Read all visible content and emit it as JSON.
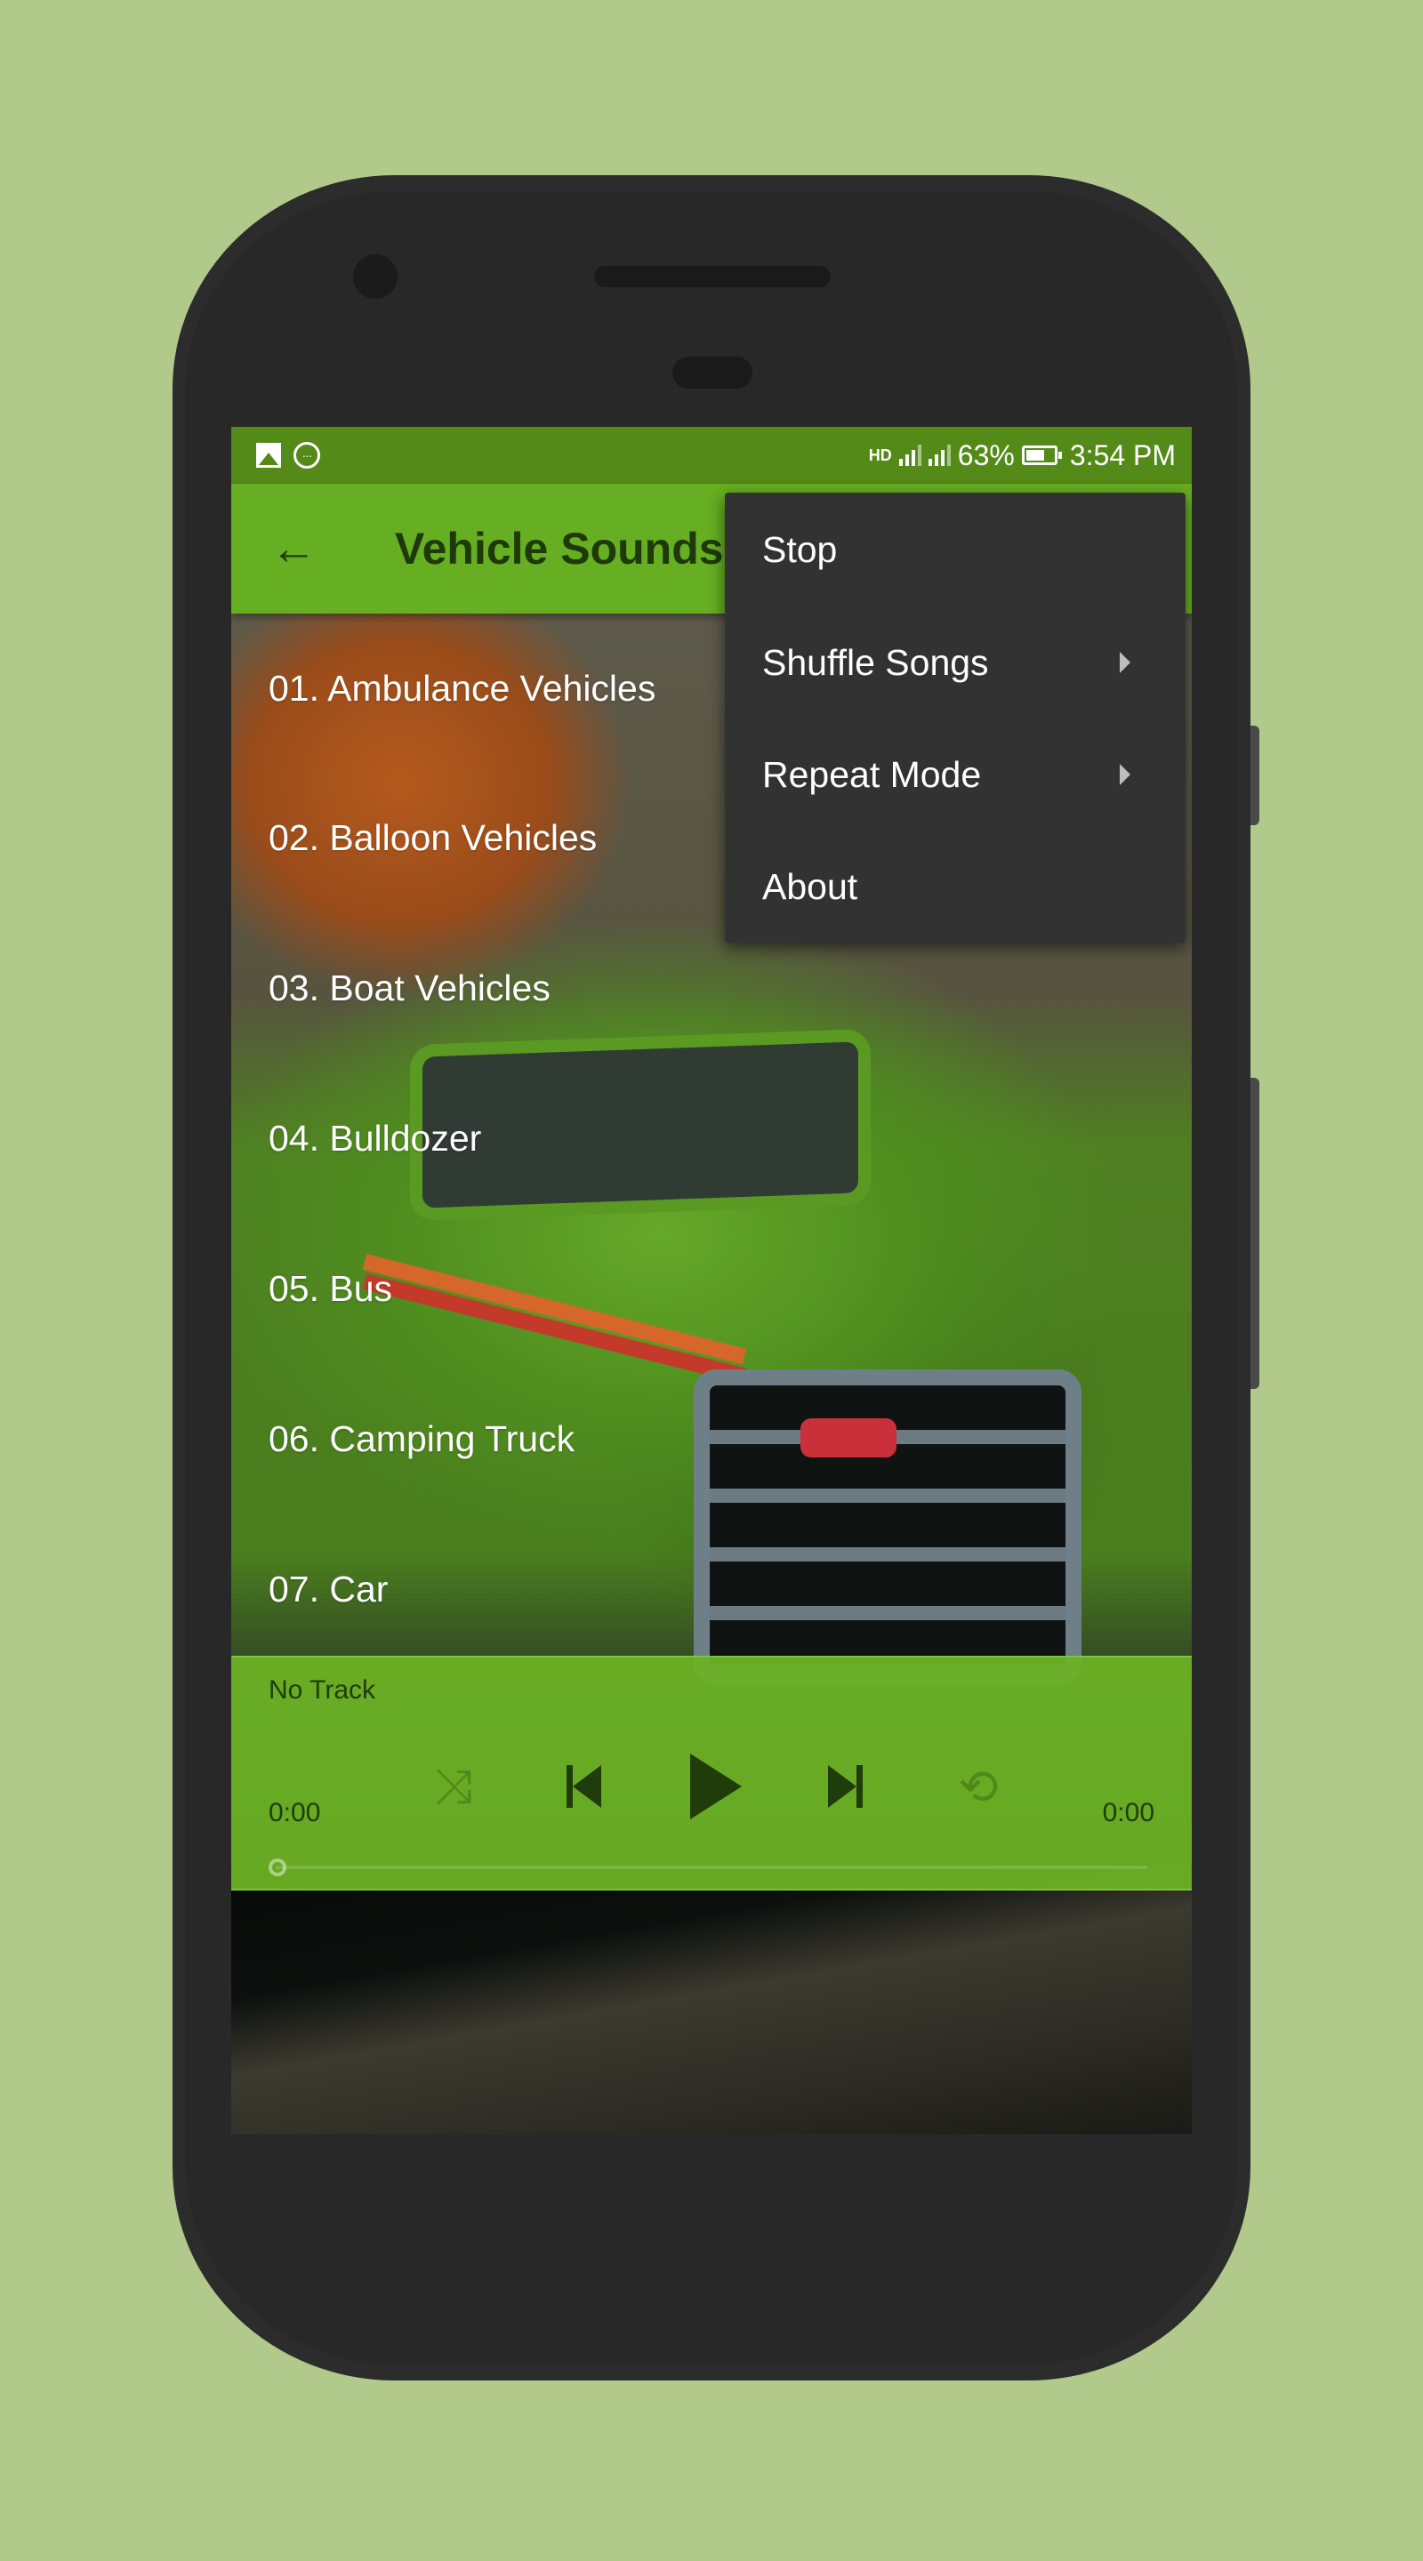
{
  "status_bar": {
    "left_icons": [
      "gallery-icon",
      "message-icon"
    ],
    "right_icons": [
      "hd-voice-icon",
      "signal-1-icon",
      "signal-2-icon",
      "battery-icon"
    ],
    "battery": "63%",
    "time": "3:54 PM"
  },
  "app_bar": {
    "back_icon": "arrow-left-icon",
    "title": "Vehicle Sounds"
  },
  "tracks": [
    {
      "label": "01. Ambulance Vehicles"
    },
    {
      "label": "02. Balloon Vehicles"
    },
    {
      "label": "03. Boat Vehicles"
    },
    {
      "label": "04. Bulldozer"
    },
    {
      "label": "05. Bus"
    },
    {
      "label": "06. Camping Truck"
    },
    {
      "label": "07. Car"
    }
  ],
  "player": {
    "now_playing": "No Track",
    "current_time": "0:00",
    "duration": "0:00",
    "progress": 0,
    "icons": {
      "shuffle": "shuffle-icon",
      "previous": "skip-previous-icon",
      "play": "play-icon",
      "next": "skip-next-icon",
      "repeat": "repeat-icon"
    },
    "shuffle_glyph": "⤨",
    "repeat_glyph": "⟲"
  },
  "overflow_menu": {
    "items": [
      {
        "label": "Stop",
        "has_submenu": false
      },
      {
        "label": "Shuffle Songs",
        "has_submenu": true
      },
      {
        "label": "Repeat Mode",
        "has_submenu": true
      },
      {
        "label": "About",
        "has_submenu": false
      }
    ]
  },
  "colors": {
    "background": "#b1c98b",
    "status_bar": "#548b18",
    "app_bar": "#66ae22",
    "title_text": "#1e3a0a",
    "menu_bg": "#323232",
    "player_bg": "#6cb224"
  }
}
